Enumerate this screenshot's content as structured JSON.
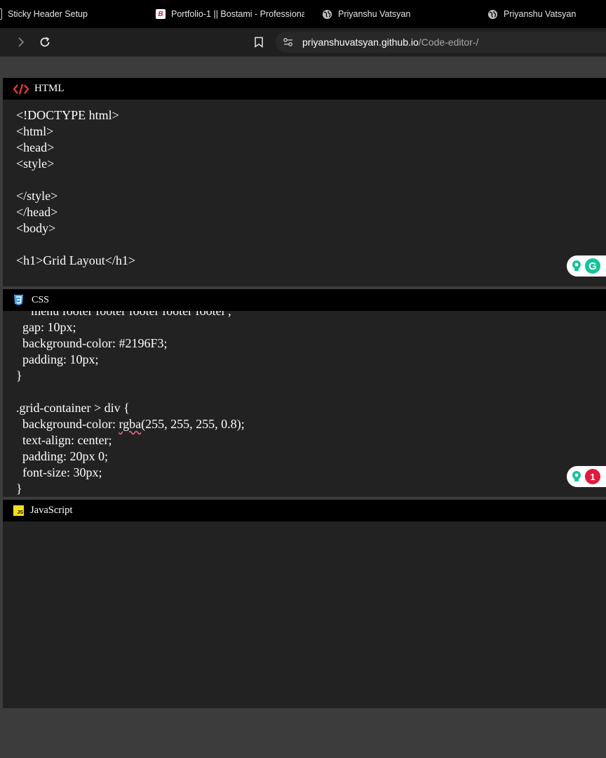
{
  "tabs": [
    {
      "title": "Sticky Header Setup"
    },
    {
      "title": "Portfolio-1 || Bostami - Professional"
    },
    {
      "title": "Priyanshu Vatsyan"
    },
    {
      "title": "Priyanshu Vatsyan"
    }
  ],
  "address": {
    "host": "priyanshuvatsyan.github.io",
    "path": "/Code-editor-/"
  },
  "icons": {
    "forward": "chevron-right-icon",
    "reload": "reload-icon",
    "bookmark": "bookmark-icon",
    "site_settings": "tune-icon",
    "html": "code-brackets-icon",
    "css": "css3-shield-icon",
    "js": "js-logo-icon",
    "grammarly": "grammarly-icon"
  },
  "panels": {
    "html": {
      "label": "HTML",
      "code": "<!DOCTYPE html>\n<html>\n<head>\n<style>\n\n</style>\n</head>\n<body>\n\n<h1>Grid Layout</h1>"
    },
    "css": {
      "label": "CSS",
      "code_top": "    'menu footer footer footer footer footer';\n  gap: 10px;\n  background-color: #2196F3;\n  padding: 10px;\n}\n\n.grid-container > div {\n  background-color: ",
      "code_underlined": "rgba",
      "code_bottom": "(255, 255, 255, 0.8);\n  text-align: center;\n  padding: 20px 0;\n  font-size: 30px;\n}"
    },
    "js": {
      "label": "JavaScript",
      "code": ""
    }
  },
  "grammarly": {
    "html_logo": "G",
    "css_count": "1"
  },
  "colors": {
    "html_icon": "#e53935",
    "css_icon": "#42a5f5",
    "js_icon": "#f7df1e",
    "grammarly_green": "#15c39a",
    "grammarly_red": "#e0193f"
  }
}
